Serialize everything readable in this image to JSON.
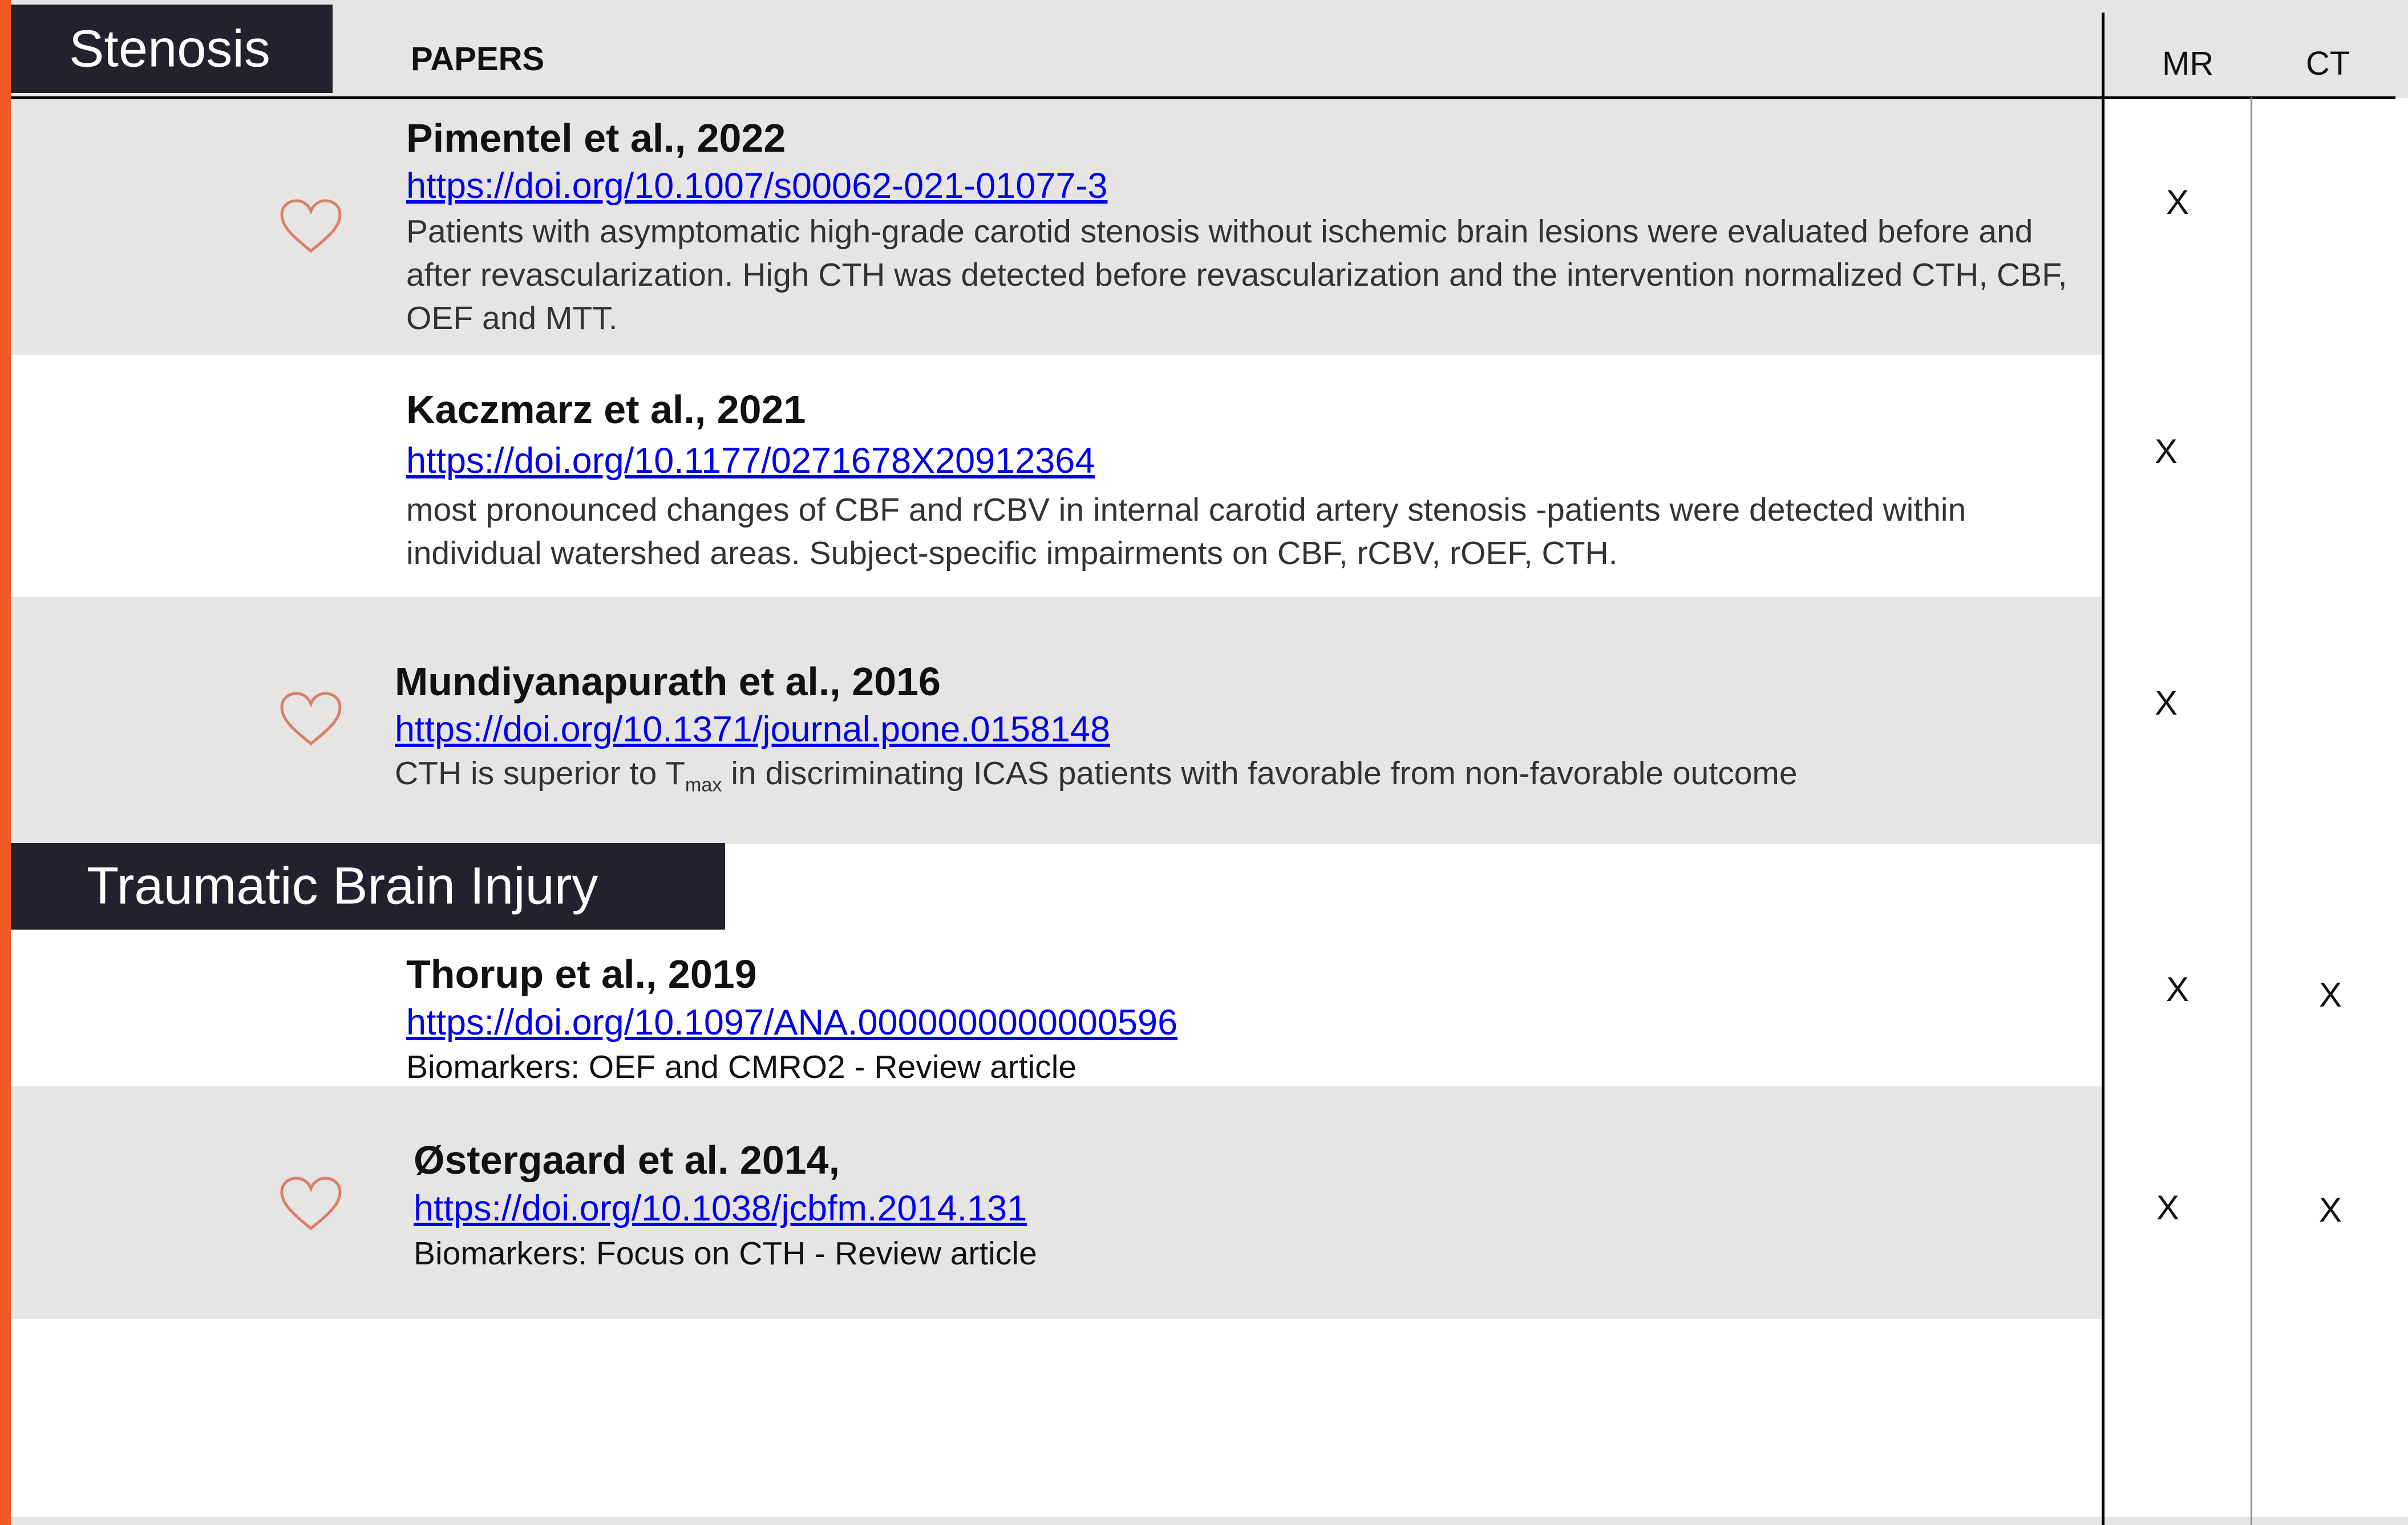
{
  "colors": {
    "accent": "#f05a22",
    "section_bg": "#22222e",
    "row_gray": "#e6e5e4",
    "link": "#0000ee",
    "heart": "#d9806a"
  },
  "header": {
    "papers_label": "PAPERS",
    "mr_label": "MR",
    "ct_label": "CT"
  },
  "sections": [
    {
      "title": "Stenosis"
    },
    {
      "title": "Traumatic Brain Injury"
    }
  ],
  "rows": [
    {
      "title": "Pimentel et al., 2022",
      "doi": "https://doi.org/10.1007/s00062-021-01077-3",
      "description": "Patients with asymptomatic high-grade carotid stenosis without ischemic brain lesions were evaluated before and after revascularization. High CTH was detected before revascularization and the intervention normalized CTH, CBF, OEF and MTT.",
      "mr": "X",
      "ct": "",
      "icon": "heart-icon"
    },
    {
      "title": "Kaczmarz et al., 2021",
      "doi": "https://doi.org/10.1177/0271678X20912364",
      "description": "most pronounced changes of CBF and rCBV in internal carotid artery stenosis -patients were detected within individual watershed areas. Subject-specific impairments on CBF, rCBV, rOEF, CTH.",
      "mr": "X",
      "ct": ""
    },
    {
      "title": "Mundiyanapurath et al., 2016",
      "doi": "https://doi.org/10.1371/journal.pone.0158148",
      "description_pre": "CTH is superior to T",
      "description_sub": "max",
      "description_post": " in discriminating ICAS patients with favorable from non-favorable outcome",
      "mr": "X",
      "ct": "",
      "icon": "heart-icon"
    },
    {
      "title": "Thorup et al., 2019",
      "doi": "https://doi.org/10.1097/ANA.0000000000000596",
      "description": "Biomarkers: OEF and CMRO2 - Review article",
      "mr": "X",
      "ct": "X"
    },
    {
      "title": "Østergaard et al. 2014,",
      "doi": "https://doi.org/10.1038/jcbfm.2014.131",
      "description": "Biomarkers: Focus on CTH - Review article",
      "mr": "X",
      "ct": "X",
      "icon": "heart-icon"
    }
  ]
}
